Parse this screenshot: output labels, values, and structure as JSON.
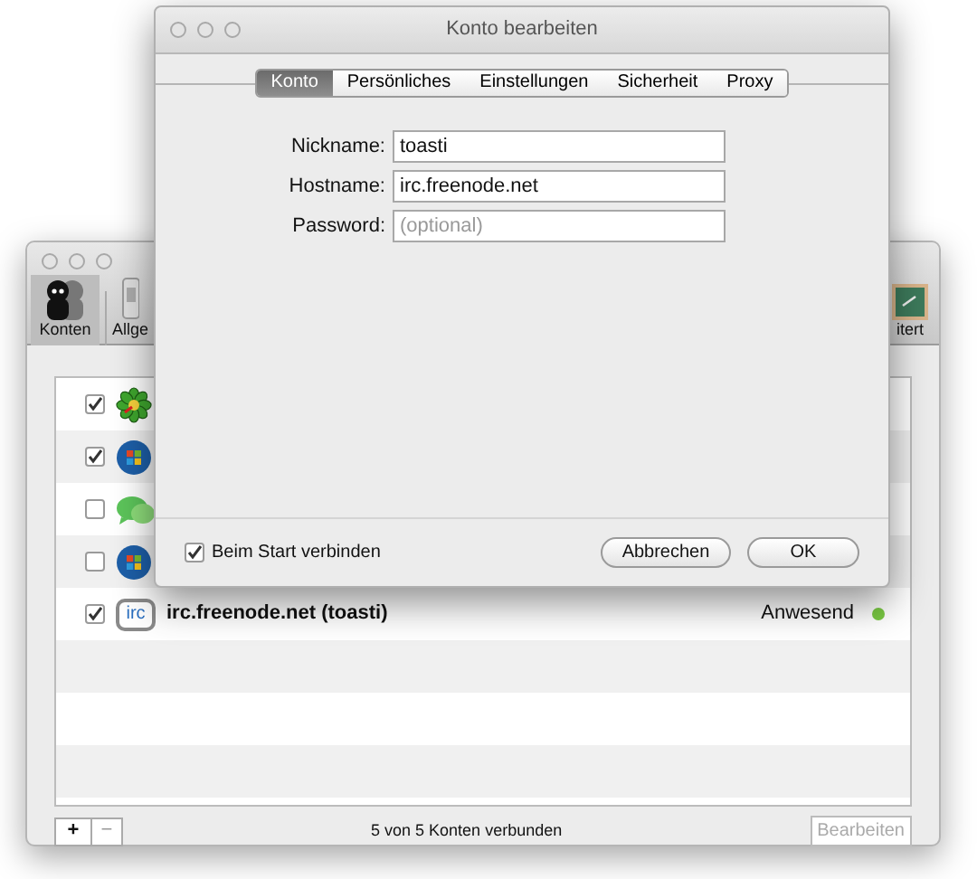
{
  "main_window": {
    "toolbar": [
      {
        "label": "Konten",
        "kind": "people",
        "selected": true
      },
      {
        "label": "Allge",
        "kind": "switch",
        "selected": false
      },
      {
        "label": "itert",
        "kind": "board",
        "selected": false
      }
    ],
    "accounts": [
      {
        "kind": "flower",
        "checked": true
      },
      {
        "kind": "orb",
        "checked": true
      },
      {
        "kind": "chat",
        "checked": false
      },
      {
        "kind": "orb",
        "checked": false
      },
      {
        "kind": "irc",
        "icon_text": "irc",
        "checked": true,
        "name": "irc.freenode.net (toasti)",
        "status": "Anwesend",
        "color": "#7ac943"
      }
    ],
    "add_button": "+",
    "remove_button": "−",
    "summary": "5 von 5 Konten verbunden",
    "edit_button": {
      "label": "Bearbeiten",
      "disabled": true
    }
  },
  "sheet": {
    "title": "Konto bearbeiten",
    "tabs": [
      {
        "label": "Konto",
        "selected": true
      },
      {
        "label": "Persönliches",
        "selected": false
      },
      {
        "label": "Einstellungen",
        "selected": false
      },
      {
        "label": "Sicherheit",
        "selected": false
      },
      {
        "label": "Proxy",
        "selected": false
      }
    ],
    "fields": [
      {
        "label": "Nickname:",
        "value": "toasti"
      },
      {
        "label": "Hostname:",
        "value": "irc.freenode.net"
      },
      {
        "label": "Password:",
        "placeholder": "(optional)"
      }
    ],
    "connect_on_start": {
      "label": "Beim Start verbinden",
      "checked": true
    },
    "buttons": [
      "Abbrechen",
      "OK"
    ]
  }
}
